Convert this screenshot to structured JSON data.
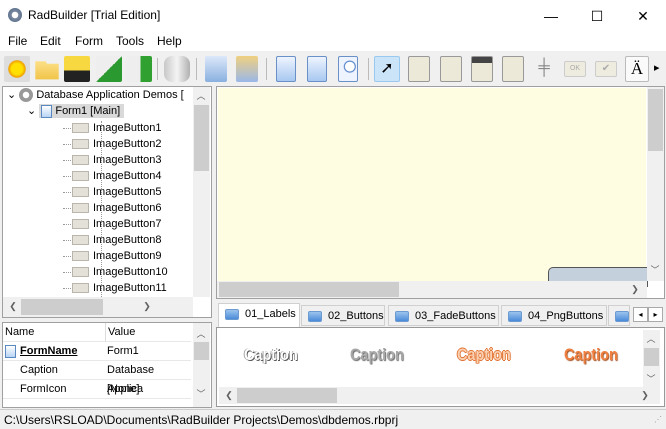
{
  "window": {
    "title": "RadBuilder [Trial Edition]",
    "minimize": "—",
    "maximize": "☐",
    "close": "✕"
  },
  "menu": [
    "File",
    "Edit",
    "Form",
    "Tools",
    "Help"
  ],
  "toolbar": {
    "icons": [
      "new-project-icon",
      "open-folder-icon",
      "save-icon",
      "build-icon",
      "run-icon",
      "database-icon",
      "copy-icon",
      "paste-icon",
      "new-form-icon",
      "form-properties-icon",
      "preview-icon",
      "pointer-icon",
      "panel-icon",
      "group-box-icon",
      "tab-panel-icon",
      "grid-icon",
      "splitter-icon",
      "ok-button-icon",
      "check-icon",
      "text-font-icon"
    ],
    "ok_label": "OK",
    "font_label": "Ä",
    "more": "▸"
  },
  "tree": {
    "root": "Database Application Demos [",
    "form": "Form1 [Main]",
    "items": [
      "ImageButton1",
      "ImageButton2",
      "ImageButton3",
      "ImageButton4",
      "ImageButton5",
      "ImageButton6",
      "ImageButton7",
      "ImageButton8",
      "ImageButton9",
      "ImageButton10",
      "ImageButton11"
    ]
  },
  "properties": {
    "headers": [
      "Name",
      "Value"
    ],
    "rows": [
      {
        "name": "FormName",
        "value": "Form1"
      },
      {
        "name": "Caption",
        "value": "Database Applica"
      },
      {
        "name": "FormIcon",
        "value": "[None]"
      }
    ]
  },
  "tabs": [
    "01_Labels",
    "02_Buttons",
    "03_FadeButtons",
    "04_PngButtons"
  ],
  "captions": [
    "Caption",
    "Caption",
    "Caption",
    "Caption"
  ],
  "colors": {
    "canvas": "#fffde1",
    "accent_orange": "#f08040"
  },
  "status": "C:\\Users\\RSLOAD\\Documents\\RadBuilder Projects\\Demos\\dbdemos.rbprj"
}
